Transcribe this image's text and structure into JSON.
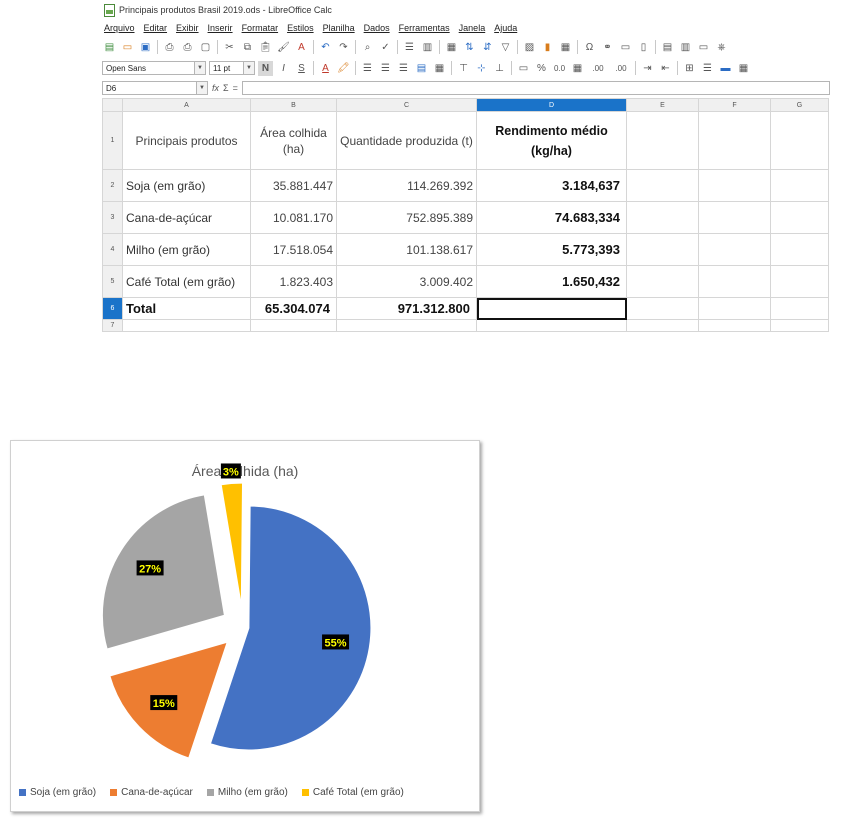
{
  "window": {
    "title": "Principais produtos Brasil 2019.ods - LibreOffice Calc"
  },
  "menu": [
    "Arquivo",
    "Editar",
    "Exibir",
    "Inserir",
    "Formatar",
    "Estilos",
    "Planilha",
    "Dados",
    "Ferramentas",
    "Janela",
    "Ajuda"
  ],
  "format_toolbar": {
    "font_name": "Open Sans",
    "font_size": "11 pt",
    "bold_label": "N",
    "italic_label": "I",
    "underline_label": "S",
    "underline_color_label": "A",
    "percent": "%",
    "number_00": "0.0",
    "decimal_add": ".00",
    "decimal_remove": ".00"
  },
  "formula_bar": {
    "cell_ref": "D6",
    "fx": "fx",
    "sum": "Σ",
    "equals": "="
  },
  "grid": {
    "columns": [
      "A",
      "B",
      "C",
      "D",
      "E",
      "F",
      "G"
    ],
    "rows": [
      [
        "1",
        "Principais produtos",
        "Área colhida (ha)",
        "Quantidade produzida (t)",
        "Rendimento médio (kg/ha)"
      ],
      [
        "2",
        "Soja (em grão)",
        "35.881.447",
        "114.269.392",
        "3.184,637"
      ],
      [
        "3",
        "Cana-de-açúcar",
        "10.081.170",
        "752.895.389",
        "74.683,334"
      ],
      [
        "4",
        "Milho (em grão)",
        "17.518.054",
        "101.138.617",
        "5.773,393"
      ],
      [
        "5",
        "Café Total (em grão)",
        "1.823.403",
        "3.009.402",
        "1.650,432"
      ],
      [
        "6",
        "Total",
        "65.304.074",
        "971.312.800",
        ""
      ],
      [
        "7",
        "",
        "",
        "",
        ""
      ]
    ]
  },
  "chart_data": {
    "type": "pie",
    "title": "Área colhida (ha)",
    "categories": [
      "Soja (em grão)",
      "Cana-de-açúcar",
      "Milho (em grão)",
      "Café Total (em grão)"
    ],
    "values": [
      35881447,
      10081170,
      17518054,
      1823403
    ],
    "labels": [
      "55%",
      "15%",
      "27%",
      "3%"
    ],
    "colors": [
      "#4472C4",
      "#ED7D31",
      "#A5A5A5",
      "#FFC000"
    ],
    "exploded": true,
    "legend_position": "bottom"
  }
}
